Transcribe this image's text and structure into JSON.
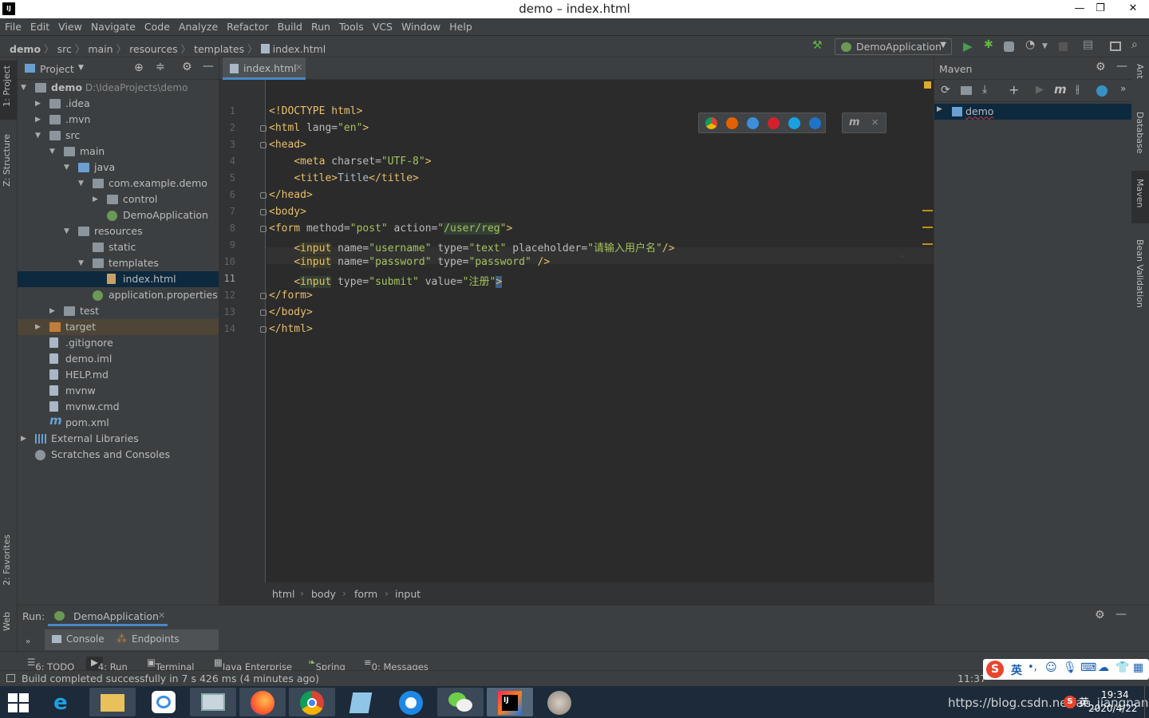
{
  "window": {
    "title": "demo – index.html",
    "logo": "IJ"
  },
  "menu": [
    "File",
    "Edit",
    "View",
    "Navigate",
    "Code",
    "Analyze",
    "Refactor",
    "Build",
    "Run",
    "Tools",
    "VCS",
    "Window",
    "Help"
  ],
  "nav": {
    "breadcrumbs": [
      "demo",
      "src",
      "main",
      "resources",
      "templates",
      "index.html"
    ],
    "run_config": "DemoApplication"
  },
  "left_strip": {
    "project": "1: Project",
    "structure": "Z: Structure",
    "favorites": "2: Favorites",
    "web": "Web"
  },
  "project_panel": {
    "title": "Project",
    "tree": [
      {
        "label": "demo",
        "extra": "D:\\IdeaProjects\\demo",
        "depth": 0,
        "arrow": "down",
        "icon": "folder"
      },
      {
        "label": ".idea",
        "depth": 1,
        "arrow": "right",
        "icon": "folder"
      },
      {
        "label": ".mvn",
        "depth": 1,
        "arrow": "right",
        "icon": "folder"
      },
      {
        "label": "src",
        "depth": 1,
        "arrow": "down",
        "icon": "folder"
      },
      {
        "label": "main",
        "depth": 2,
        "arrow": "down",
        "icon": "folder"
      },
      {
        "label": "java",
        "depth": 3,
        "arrow": "down",
        "icon": "folder-blue"
      },
      {
        "label": "com.example.demo",
        "depth": 4,
        "arrow": "down",
        "icon": "folder"
      },
      {
        "label": "control",
        "depth": 5,
        "arrow": "right",
        "icon": "folder"
      },
      {
        "label": "DemoApplication",
        "depth": 5,
        "arrow": "",
        "icon": "spring"
      },
      {
        "label": "resources",
        "depth": 3,
        "arrow": "down",
        "icon": "folder"
      },
      {
        "label": "static",
        "depth": 4,
        "arrow": "",
        "icon": "folder"
      },
      {
        "label": "templates",
        "depth": 4,
        "arrow": "down",
        "icon": "folder"
      },
      {
        "label": "index.html",
        "depth": 5,
        "arrow": "",
        "icon": "html",
        "selected": true
      },
      {
        "label": "application.properties",
        "depth": 4,
        "arrow": "",
        "icon": "spring"
      },
      {
        "label": "test",
        "depth": 2,
        "arrow": "right",
        "icon": "folder"
      },
      {
        "label": "target",
        "depth": 1,
        "arrow": "right",
        "icon": "folder-orange",
        "target": true
      },
      {
        "label": ".gitignore",
        "depth": 1,
        "arrow": "",
        "icon": "file"
      },
      {
        "label": "demo.iml",
        "depth": 1,
        "arrow": "",
        "icon": "file"
      },
      {
        "label": "HELP.md",
        "depth": 1,
        "arrow": "",
        "icon": "file"
      },
      {
        "label": "mvnw",
        "depth": 1,
        "arrow": "",
        "icon": "file"
      },
      {
        "label": "mvnw.cmd",
        "depth": 1,
        "arrow": "",
        "icon": "file"
      },
      {
        "label": "pom.xml",
        "depth": 1,
        "arrow": "",
        "icon": "maven"
      },
      {
        "label": "External Libraries",
        "depth": 0,
        "arrow": "right",
        "icon": "libs"
      },
      {
        "label": "Scratches and Consoles",
        "depth": 0,
        "arrow": "",
        "icon": "scratch"
      }
    ]
  },
  "editor": {
    "tab": "index.html",
    "lines": [
      {
        "n": "1",
        "html": "<span class='tg'>&lt;!DOCTYPE html&gt;</span>"
      },
      {
        "n": "2",
        "html": "<span class='tg'>&lt;html </span><span class='at'>lang=</span><span class='vl'>\"en\"</span><span class='tg'>&gt;</span>"
      },
      {
        "n": "3",
        "html": "<span class='tg'>&lt;head&gt;</span>"
      },
      {
        "n": "4",
        "html": "    <span class='tg'>&lt;meta </span><span class='at'>charset=</span><span class='vl'>\"UTF-8\"</span><span class='tg'>&gt;</span>"
      },
      {
        "n": "5",
        "html": "    <span class='tg'>&lt;title&gt;</span><span class='tx'>Title</span><span class='tg'>&lt;/title&gt;</span>"
      },
      {
        "n": "6",
        "html": "<span class='tg'>&lt;/head&gt;</span>"
      },
      {
        "n": "7",
        "html": "<span class='tg'>&lt;body&gt;</span>"
      },
      {
        "n": "8",
        "html": "<span class='tg'>&lt;form </span><span class='at'>method=</span><span class='vl'>\"post\"</span><span class='at'> action=</span><span class='vl'>\"<span class='hlv'>/user/reg</span>\"</span><span class='tg'>&gt;</span>"
      },
      {
        "n": "9",
        "html": "    <span class='tg'>&lt;<span class='hl'>input</span> </span><span class='at'>name=</span><span class='vl'>\"username\"</span><span class='at'> type=</span><span class='vl'>\"text\"</span><span class='at'> placeholder=</span><span class='vl'>\"请输入用户名\"</span><span class='tg'>/&gt;</span>"
      },
      {
        "n": "10",
        "html": "    <span class='tg'>&lt;<span class='hl'>input</span> </span><span class='at'>name=</span><span class='vl'>\"password\"</span><span class='at'> type=</span><span class='vl'>\"password\"</span><span class='tg'> /&gt;</span>"
      },
      {
        "n": "11",
        "html": "    <span class='tg'>&lt;<span class='hlv'>input</span> </span><span class='at'>type=</span><span class='vl'>\"submit\"</span><span class='at'> value=</span><span class='vl'>\"注册\"</span><span class='tg' style='background:#3d6185'>&gt;</span>"
      },
      {
        "n": "12",
        "html": "<span class='tg'>&lt;/form&gt;</span>"
      },
      {
        "n": "13",
        "html": "<span class='tg'>&lt;/body&gt;</span>"
      },
      {
        "n": "14",
        "html": "<span class='tg'>&lt;/html&gt;</span>"
      }
    ],
    "breadcrumbs": [
      "html",
      "body",
      "form",
      "input"
    ]
  },
  "maven": {
    "title": "Maven",
    "root": "demo"
  },
  "right_strip": {
    "ant": "Ant",
    "database": "Database",
    "maven": "Maven",
    "bean": "Bean Validation"
  },
  "run_panel": {
    "label": "Run:",
    "config": "DemoApplication",
    "tabs": [
      "Console",
      "Endpoints"
    ]
  },
  "bottom_tabs": [
    "6: TODO",
    "4: Run",
    "Terminal",
    "Java Enterprise",
    "Spring",
    "0: Messages"
  ],
  "status": {
    "message": "Build completed successfully in 7 s 426 ms (4 minutes ago)",
    "position": "11:37",
    "ime": "英"
  },
  "taskbar": {
    "watermark": "https://blog.csdn.net/an_jiangnan",
    "time": "19:34",
    "date": "2020/4/22",
    "ime": "英"
  },
  "colors": {
    "accent": "#4a88c7",
    "editor_bg": "#2b2b2b",
    "panel_bg": "#3c3f41",
    "selected": "#0d293e",
    "tag": "#e8bf6a",
    "string": "#a5c25c"
  }
}
